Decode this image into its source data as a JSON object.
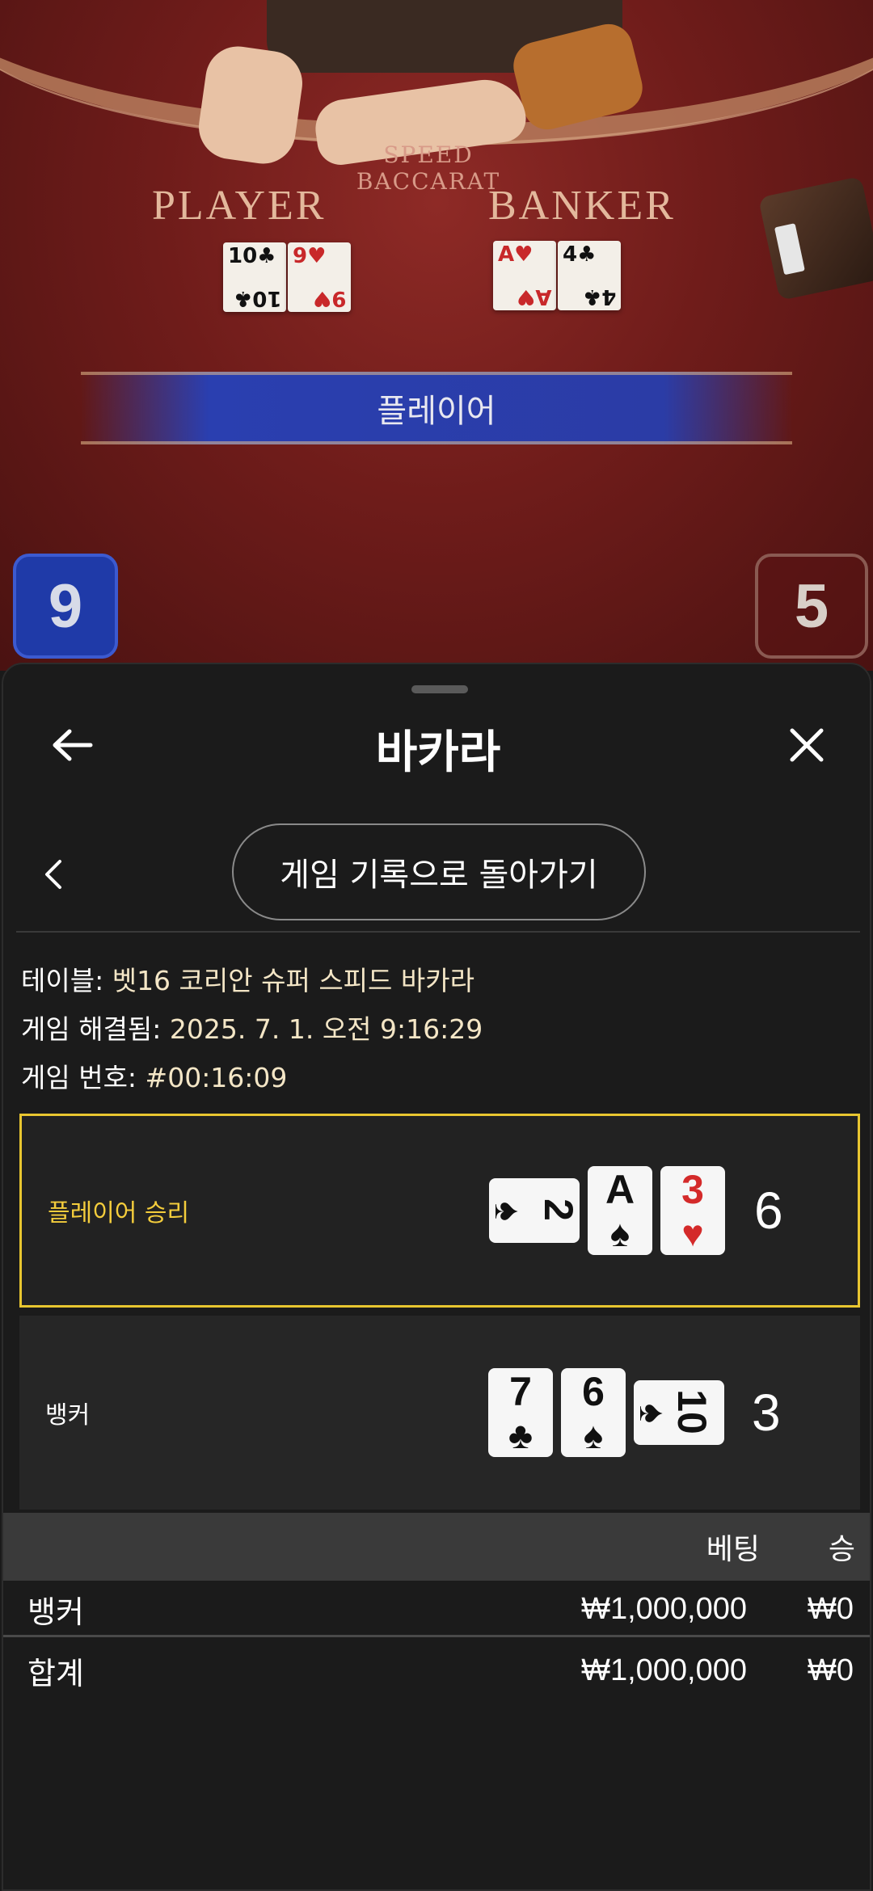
{
  "video": {
    "table_logo": "SPEED BACCARAT",
    "player_label": "PLAYER",
    "banker_label": "BANKER",
    "player_cards": [
      {
        "rank": "10",
        "suit": "♣",
        "color": "#111111"
      },
      {
        "rank": "9",
        "suit": "♥",
        "color": "#c8282a"
      }
    ],
    "banker_cards": [
      {
        "rank": "A",
        "suit": "♥",
        "color": "#c8282a"
      },
      {
        "rank": "4",
        "suit": "♣",
        "color": "#111111"
      }
    ],
    "winner_banner": "플레이어",
    "player_score": "9",
    "banker_score": "5"
  },
  "sheet": {
    "title": "바카라",
    "back_icon": "arrow-left-icon",
    "close_icon": "close-icon",
    "chevron_icon": "chevron-left-icon",
    "back_to_history": "게임 기록으로 돌아가기",
    "table_key": "테이블: ",
    "table_value": "벳16 코리안 슈퍼 스피드 바카라",
    "resolved_key": "게임 해결됨: ",
    "resolved_value": "2025. 7. 1. 오전 9:16:29",
    "game_no_key": "게임 번호: ",
    "game_no_value": "#00:16:09",
    "player_hand": {
      "label": "플레이어 승리",
      "total": "6",
      "cards": [
        {
          "rank": "2",
          "suit": "♠",
          "orientation": "side",
          "red": false
        },
        {
          "rank": "A",
          "suit": "♠",
          "orientation": "up",
          "red": false
        },
        {
          "rank": "3",
          "suit": "♥",
          "orientation": "up",
          "red": true
        }
      ]
    },
    "banker_hand": {
      "label": "뱅커",
      "total": "3",
      "cards": [
        {
          "rank": "7",
          "suit": "♣",
          "orientation": "up",
          "red": false
        },
        {
          "rank": "6",
          "suit": "♠",
          "orientation": "up",
          "red": false
        },
        {
          "rank": "10",
          "suit": "♠",
          "orientation": "side",
          "red": false
        }
      ]
    },
    "bets": {
      "col_bet": "베팅",
      "col_win": "승",
      "rows": [
        {
          "label": "뱅커",
          "bet": "₩1,000,000",
          "win": "₩0"
        }
      ],
      "total": {
        "label": "합계",
        "bet": "₩1,000,000",
        "win": "₩0"
      }
    }
  },
  "colors": {
    "accent_yellow": "#e8c630",
    "player_blue": "#1f3aa8",
    "sheet_bg": "#1b1b1b",
    "table_red": "#7a1f1c"
  }
}
